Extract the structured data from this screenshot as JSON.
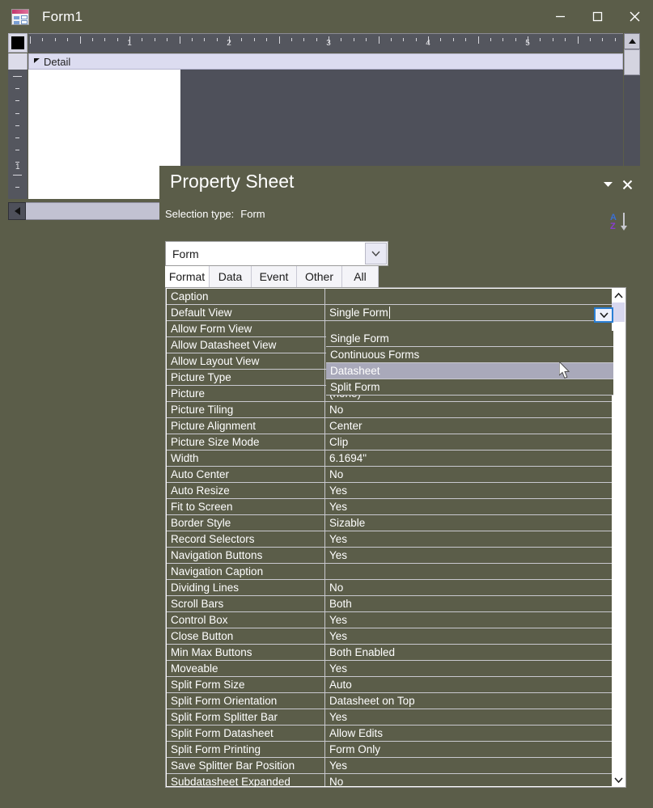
{
  "window": {
    "title": "Form1",
    "icon": "form-design-icon",
    "controls": {
      "minimize": "minimize-icon",
      "maximize": "maximize-icon",
      "close": "close-icon"
    }
  },
  "designer": {
    "band_label": "Detail",
    "hruler_labels": [
      "1",
      "2",
      "3",
      "4",
      "5"
    ],
    "vruler_labels": [
      "1"
    ],
    "scroll_up": "scroll-up-arrow",
    "scroll_left": "scroll-left-arrow"
  },
  "property_sheet": {
    "title": "Property Sheet",
    "selection_type_label": "Selection type:",
    "selection_type_value": "Form",
    "sort_icon": "sort-az-icon",
    "minimize_icon": "chevron-down-icon",
    "close_icon": "close-icon",
    "object_combo": {
      "value": "Form",
      "dropdown_icon": "chevron-down-icon"
    },
    "tabs": [
      {
        "label": "Format",
        "active": true
      },
      {
        "label": "Data",
        "active": false
      },
      {
        "label": "Event",
        "active": false
      },
      {
        "label": "Other",
        "active": false
      },
      {
        "label": "All",
        "active": false
      }
    ],
    "open_dropdown": {
      "property": "Default View",
      "current_value": "Single Form",
      "options": [
        {
          "label": "Single Form",
          "selected": false
        },
        {
          "label": "Continuous Forms",
          "selected": false
        },
        {
          "label": "Datasheet",
          "selected": true
        },
        {
          "label": "Split Form",
          "selected": false
        }
      ]
    },
    "rows": [
      {
        "name": "Caption",
        "value": ""
      },
      {
        "name": "Default View",
        "value": "Single Form",
        "editing": true
      },
      {
        "name": "Allow Form View",
        "value": ""
      },
      {
        "name": "Allow Datasheet View",
        "value": ""
      },
      {
        "name": "Allow Layout View",
        "value": ""
      },
      {
        "name": "Picture Type",
        "value": ""
      },
      {
        "name": "Picture",
        "value": "(none)"
      },
      {
        "name": "Picture Tiling",
        "value": "No"
      },
      {
        "name": "Picture Alignment",
        "value": "Center"
      },
      {
        "name": "Picture Size Mode",
        "value": "Clip"
      },
      {
        "name": "Width",
        "value": "6.1694\""
      },
      {
        "name": "Auto Center",
        "value": "No"
      },
      {
        "name": "Auto Resize",
        "value": "Yes"
      },
      {
        "name": "Fit to Screen",
        "value": "Yes"
      },
      {
        "name": "Border Style",
        "value": "Sizable"
      },
      {
        "name": "Record Selectors",
        "value": "Yes"
      },
      {
        "name": "Navigation Buttons",
        "value": "Yes"
      },
      {
        "name": "Navigation Caption",
        "value": ""
      },
      {
        "name": "Dividing Lines",
        "value": "No"
      },
      {
        "name": "Scroll Bars",
        "value": "Both"
      },
      {
        "name": "Control Box",
        "value": "Yes"
      },
      {
        "name": "Close Button",
        "value": "Yes"
      },
      {
        "name": "Min Max Buttons",
        "value": "Both Enabled"
      },
      {
        "name": "Moveable",
        "value": "Yes"
      },
      {
        "name": "Split Form Size",
        "value": "Auto"
      },
      {
        "name": "Split Form Orientation",
        "value": "Datasheet on Top"
      },
      {
        "name": "Split Form Splitter Bar",
        "value": "Yes"
      },
      {
        "name": "Split Form Datasheet",
        "value": "Allow Edits"
      },
      {
        "name": "Split Form Printing",
        "value": "Form Only"
      },
      {
        "name": "Save Splitter Bar Position",
        "value": "Yes"
      },
      {
        "name": "Subdatasheet Expanded",
        "value": "No"
      },
      {
        "name": "",
        "value": ""
      }
    ],
    "scrollbar": {
      "up_icon": "scroll-up-chevron",
      "down_icon": "scroll-down-chevron"
    }
  },
  "colors": {
    "window_background": "#5b5d49",
    "panel_background": "#5b5d49",
    "grid_background": "#ffffff",
    "text": "#ffffff",
    "highlight": "#a9a9ba",
    "focus_border": "#2a7fd4",
    "ruler": "#54565e",
    "band": "#dcdcf0"
  }
}
